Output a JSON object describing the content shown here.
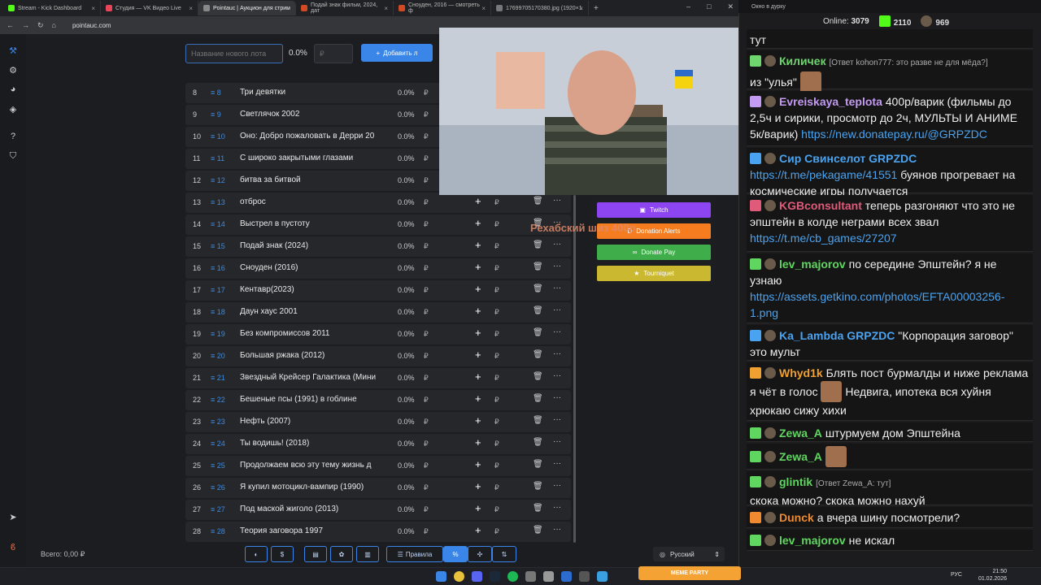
{
  "browser": {
    "tabs": [
      {
        "label": "Stream - Kick Dashboard",
        "color": "#53fc18"
      },
      {
        "label": "Студия — VK Видео Live",
        "color": "#e8455a"
      },
      {
        "label": "Pointauc | Аукцион для стрим",
        "color": "#888888"
      },
      {
        "label": "Подай знак фильм, 2024, дат",
        "color": "#d14a24"
      },
      {
        "label": "Сноуден, 2016 — смотреть ф",
        "color": "#d14a24"
      },
      {
        "label": "17699705170380.jpg (1920×1",
        "color": "#777777"
      }
    ],
    "url": "pointauc.com"
  },
  "auction": {
    "lot_placeholder": "Название нового лота",
    "percent": "0.0%",
    "amount_placeholder": "₽",
    "add_button": "Добавить л",
    "rows": [
      {
        "n": "8",
        "id": "8",
        "name": "Три девятки",
        "pct": "0.0%"
      },
      {
        "n": "9",
        "id": "9",
        "name": "Светлячок 2002",
        "pct": "0.0%"
      },
      {
        "n": "10",
        "id": "10",
        "name": "Оно: Добро пожаловать в Дерри 20",
        "pct": "0.0%"
      },
      {
        "n": "11",
        "id": "11",
        "name": "С широко закрытыми глазами",
        "pct": "0.0%"
      },
      {
        "n": "12",
        "id": "12",
        "name": "битва за битвой",
        "pct": "0.0%"
      },
      {
        "n": "13",
        "id": "13",
        "name": "отброс",
        "pct": "0.0%"
      },
      {
        "n": "14",
        "id": "14",
        "name": "Выстрел в пустоту",
        "pct": "0.0%"
      },
      {
        "n": "15",
        "id": "15",
        "name": "Подай знак (2024)",
        "pct": "0.0%"
      },
      {
        "n": "16",
        "id": "16",
        "name": "Сноуден (2016)",
        "pct": "0.0%"
      },
      {
        "n": "17",
        "id": "17",
        "name": "Кентавр(2023)",
        "pct": "0.0%"
      },
      {
        "n": "18",
        "id": "18",
        "name": "Даун хаус 2001",
        "pct": "0.0%"
      },
      {
        "n": "19",
        "id": "19",
        "name": "Без компромиссов 2011",
        "pct": "0.0%"
      },
      {
        "n": "20",
        "id": "20",
        "name": "Большая ржака (2012)",
        "pct": "0.0%"
      },
      {
        "n": "21",
        "id": "21",
        "name": "Звездный Крейсер Галактика (Мини",
        "pct": "0.0%"
      },
      {
        "n": "22",
        "id": "22",
        "name": "Бешеные псы (1991) в гоблине",
        "pct": "0.0%"
      },
      {
        "n": "23",
        "id": "23",
        "name": "Нефть (2007)",
        "pct": "0.0%"
      },
      {
        "n": "24",
        "id": "24",
        "name": "Ты водишь! (2018)",
        "pct": "0.0%"
      },
      {
        "n": "25",
        "id": "25",
        "name": "Продолжаем всю эту тему жизнь д",
        "pct": "0.0%"
      },
      {
        "n": "26",
        "id": "26",
        "name": "Я купил мотоцикл-вампир (1990)",
        "pct": "0.0%"
      },
      {
        "n": "27",
        "id": "27",
        "name": "Под маской жиголо (2013)",
        "pct": "0.0%"
      },
      {
        "n": "28",
        "id": "28",
        "name": "Теория заговора 1997",
        "pct": "0.0%"
      }
    ],
    "currency": "₽",
    "total": "Всего: 0,00 ₽",
    "rules_button": "Правила",
    "language": "Русский"
  },
  "integrations": {
    "twitch": "Twitch",
    "donation_alerts": "Donation Alerts",
    "donate_pay": "Donate Pay",
    "tournquet": "Tourniquet"
  },
  "overlay_text": "Рехабский шиз 400р",
  "meme_party": "MEME PARTY",
  "chat": {
    "window_title": "Окно в дурку",
    "online_label": "Online:",
    "online": "3079",
    "kick_count": "2110",
    "other_count": "969",
    "messages": [
      {
        "user": "",
        "text": "тут"
      },
      {
        "user": "Киличек",
        "color": "#6fd66f",
        "reply": "[Ответ kohon777: это разве не для мёда?]",
        "text": "из \"улья\""
      },
      {
        "user": "Evreiskaya_teplota",
        "color": "#c39bf0",
        "text": "400р/варик (фильмы до 2,5ч и сирики, просмотр до 2ч, МУЛЬТЫ И АНИМЕ 5к/варик)",
        "link": "https://new.donatepay.ru/@GRPZDC"
      },
      {
        "user": "Сир Свинселот",
        "tag": "GRPZDC",
        "color": "#4aa3f0",
        "link": "https://t.me/pekagame/41551",
        "text": "буянов прогревает на космические игры получается"
      },
      {
        "user": "KGBconsultant",
        "color": "#e05a7a",
        "text": "теперь разгоняют что это не эпштейн в колде неграми всех звал",
        "link": "https://t.me/cb_games/27207"
      },
      {
        "user": "lev_majorov",
        "color": "#5fd65f",
        "text": "по середине Эпштейн? я не узнаю",
        "link": "https://assets.getkino.com/photos/EFTA00003256-1.png"
      },
      {
        "user": "Ka_Lambda",
        "tag": "GRPZDC",
        "color": "#4aa3f0",
        "text": "\"Корпорация заговор\" это мульт"
      },
      {
        "user": "Whyd1k",
        "color": "#f0a030",
        "text": "Блять пост бурмалды и ниже реклама я чёт в голос",
        "text2": "Недвига, ипотека вся хуйня хрюкаю сижу хихи"
      },
      {
        "user": "Zewa_A",
        "color": "#5fd65f",
        "text": "штурмуем дом Эпштейна"
      },
      {
        "user": "Zewa_A",
        "color": "#5fd65f",
        "text": ""
      },
      {
        "user": "glintik",
        "color": "#5fd65f",
        "reply": "[Ответ Zewa_A: тут]",
        "text": "скока можно? скока можно нахуй"
      },
      {
        "user": "Dunck",
        "color": "#f08a30",
        "text": "а вчера шину посмотрели?"
      },
      {
        "user": "lev_majorov",
        "color": "#5fd65f",
        "text": "не искал"
      }
    ]
  },
  "taskbar": {
    "lang": "РУС",
    "time": "21:50",
    "date": "01.02.2026"
  }
}
